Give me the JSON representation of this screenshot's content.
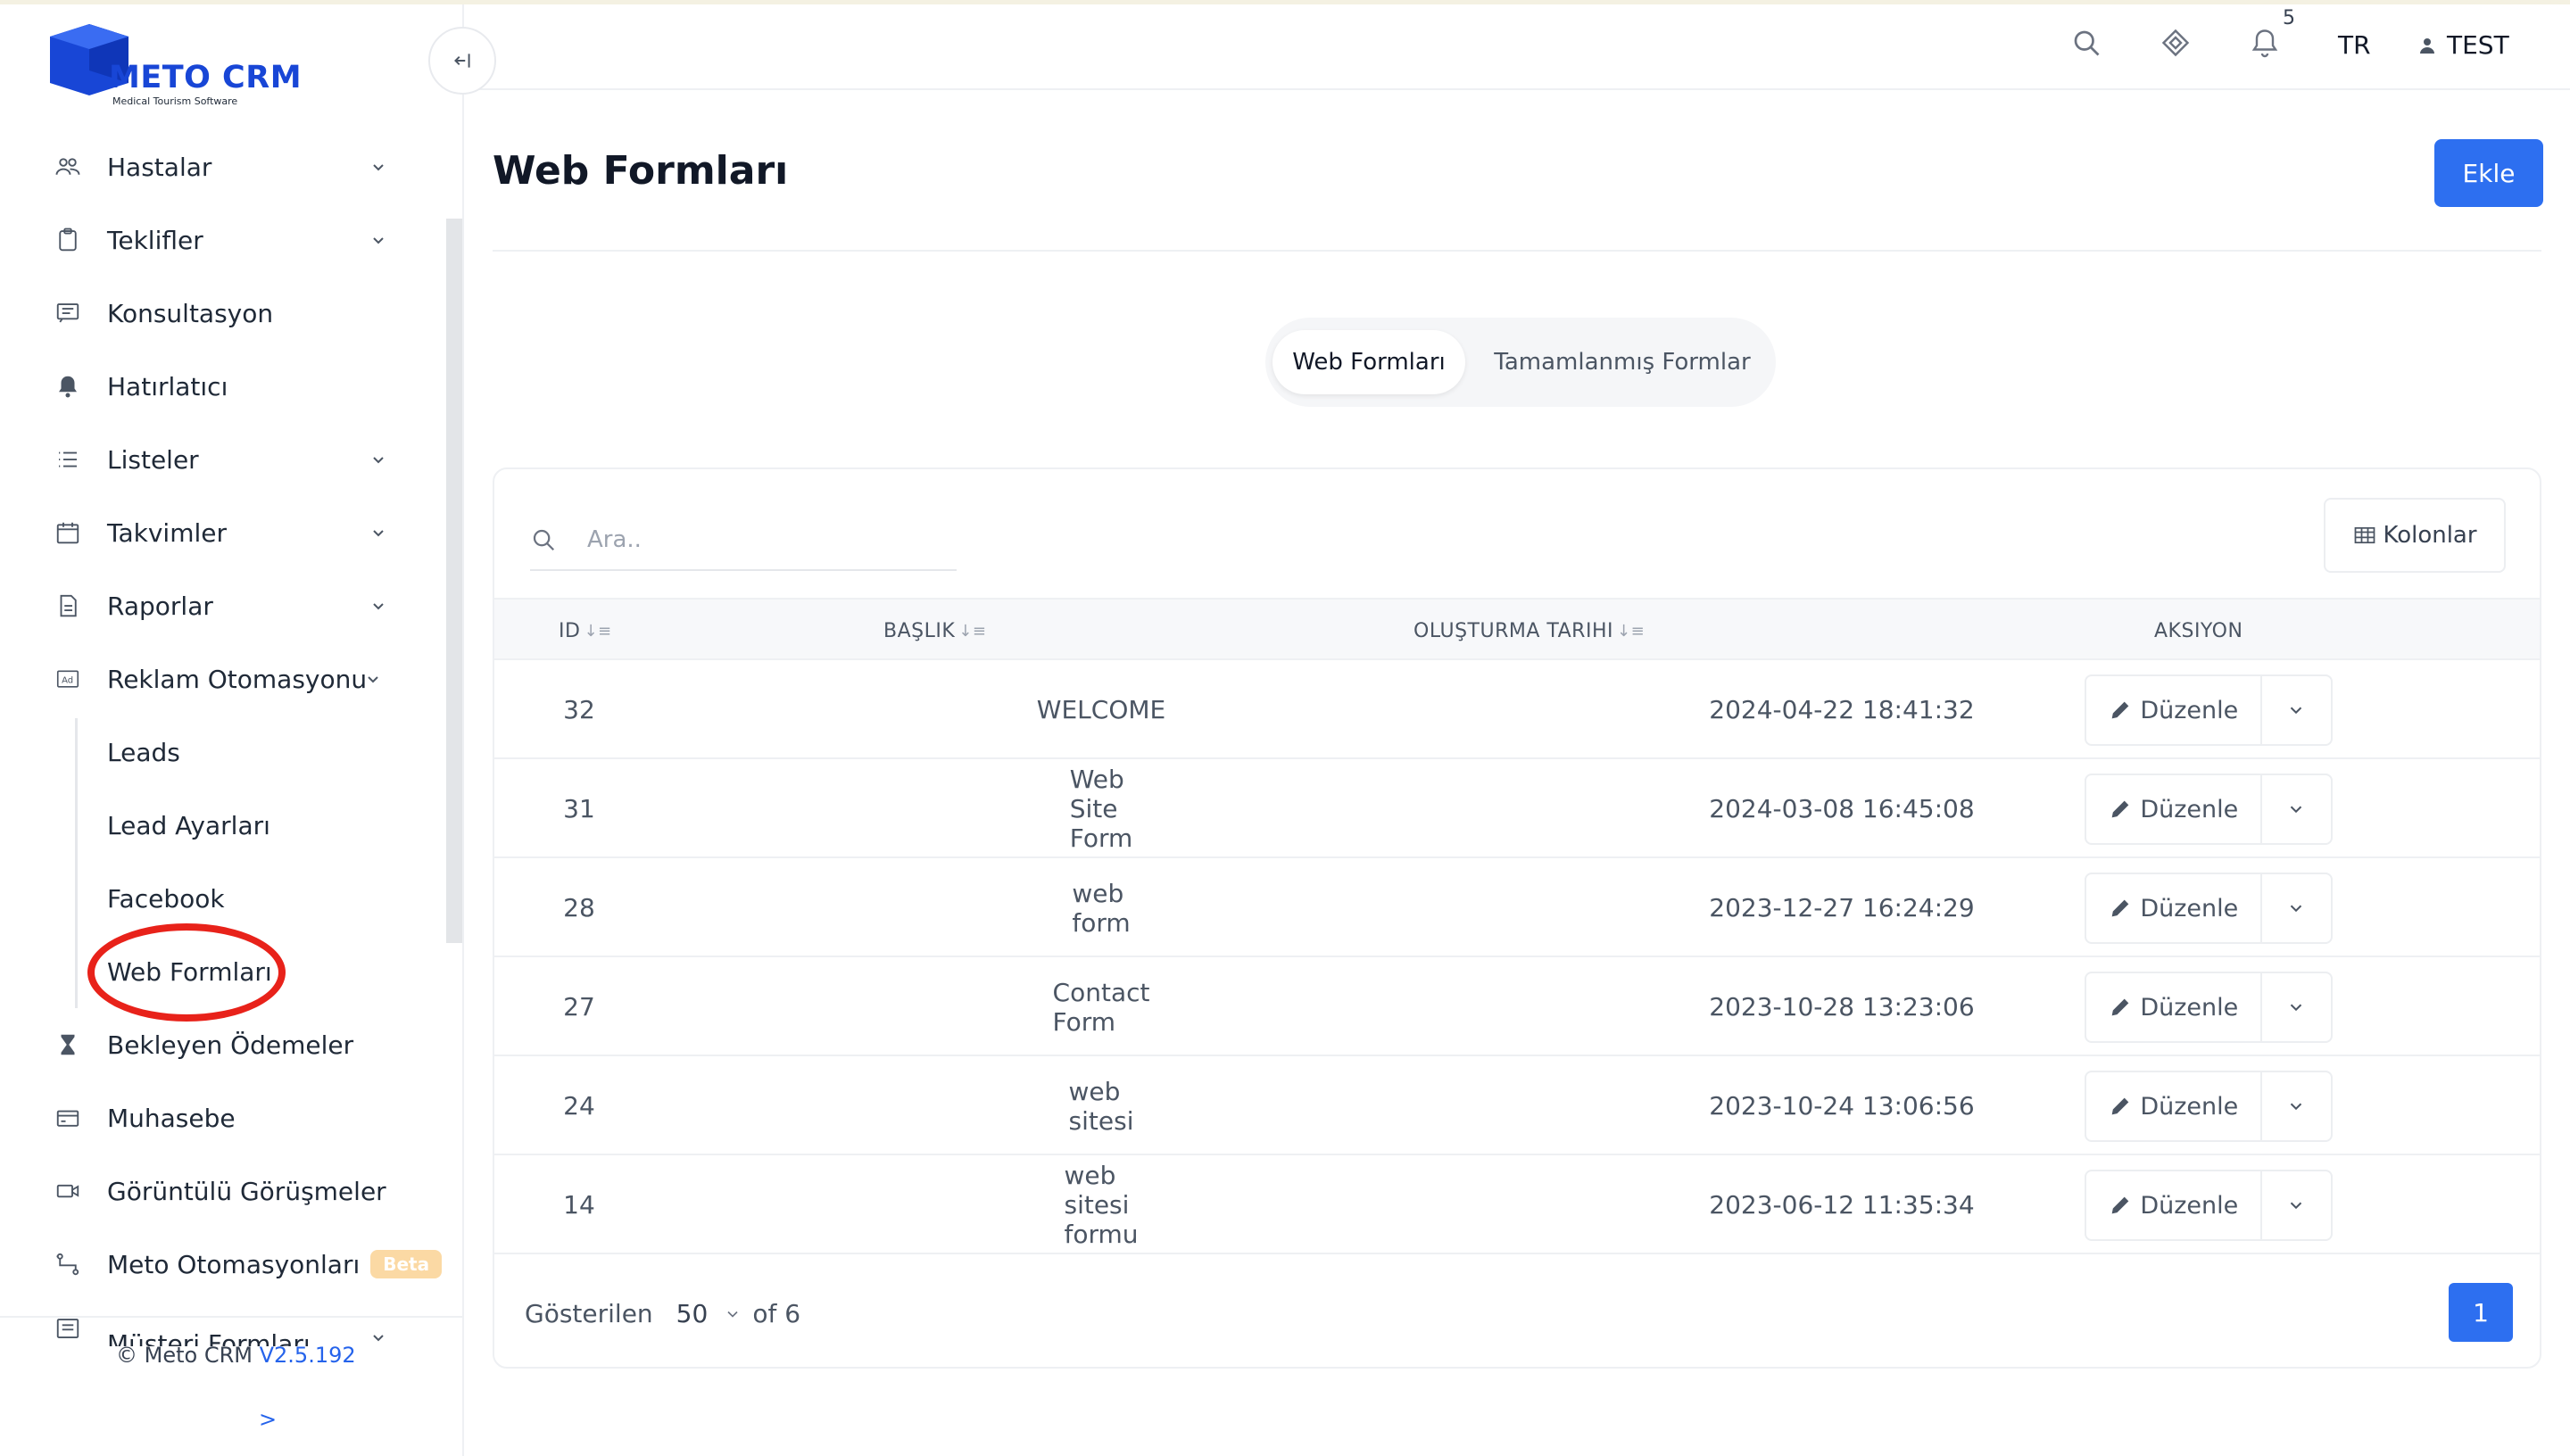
{
  "logo": {
    "brand": "METO CRM",
    "subtitle": "Medical Tourism Software",
    "color": "#1846d6"
  },
  "sidebar": {
    "items": [
      {
        "label": "Hastalar",
        "icon": "users-icon",
        "expandable": true
      },
      {
        "label": "Teklifler",
        "icon": "clipboard-icon",
        "expandable": true
      },
      {
        "label": "Konsultasyon",
        "icon": "message-icon",
        "expandable": false
      },
      {
        "label": "Hatırlatıcı",
        "icon": "bell-icon",
        "expandable": false
      },
      {
        "label": "Listeler",
        "icon": "list-icon",
        "expandable": true
      },
      {
        "label": "Takvimler",
        "icon": "calendar-icon",
        "expandable": true
      },
      {
        "label": "Raporlar",
        "icon": "document-icon",
        "expandable": true
      },
      {
        "label": "Reklam Otomasyonu",
        "icon": "ad-icon",
        "expandable": true
      },
      {
        "label": "Leads",
        "sub": true
      },
      {
        "label": "Lead Ayarları",
        "sub": true
      },
      {
        "label": "Facebook",
        "sub": true
      },
      {
        "label": "Web Formları",
        "sub": true,
        "active": true
      },
      {
        "label": "Bekleyen Ödemeler",
        "icon": "hourglass-icon",
        "expandable": false
      },
      {
        "label": "Muhasebe",
        "icon": "credit-card-icon",
        "expandable": false
      },
      {
        "label": "Görüntülü Görüşmeler",
        "icon": "video-icon",
        "expandable": false
      },
      {
        "label": "Meto Otomasyonları",
        "icon": "flow-icon",
        "expandable": false,
        "badge": "Beta"
      },
      {
        "label": "Müşteri Formları",
        "icon": "form-icon",
        "expandable": true
      }
    ],
    "footer": {
      "copyright": "© Meto CRM",
      "version": "V2.5.192",
      "expand": ">"
    }
  },
  "header": {
    "notification_count": "5",
    "language": "TR",
    "user": "TEST"
  },
  "page": {
    "title": "Web Formları",
    "add_label": "Ekle",
    "tabs": [
      "Web Formları",
      "Tamamlanmış Formlar"
    ],
    "search_placeholder": "Ara..",
    "columns_label": "Kolonlar"
  },
  "table": {
    "headers": [
      "ID",
      "BAŞLIK",
      "OLUŞTURMA TARIHI",
      "AKSIYON"
    ],
    "edit_label": "Düzenle",
    "rows": [
      {
        "id": "32",
        "title": "WELCOME",
        "date": "2024-04-22 18:41:32"
      },
      {
        "id": "31",
        "title": "Web Site Form",
        "date": "2024-03-08 16:45:08"
      },
      {
        "id": "28",
        "title": "web form",
        "date": "2023-12-27 16:24:29"
      },
      {
        "id": "27",
        "title": "Contact Form",
        "date": "2023-10-28 13:23:06"
      },
      {
        "id": "24",
        "title": "web sitesi",
        "date": "2023-10-24 13:06:56"
      },
      {
        "id": "14",
        "title": "web sitesi formu",
        "date": "2023-06-12 11:35:34"
      }
    ]
  },
  "pagination": {
    "shown_label": "Gösterilen",
    "page_size": "50",
    "total": "of 6",
    "current_page": "1"
  },
  "colors": {
    "accent": "#2d6ff0",
    "highlight": "#e8221a"
  }
}
